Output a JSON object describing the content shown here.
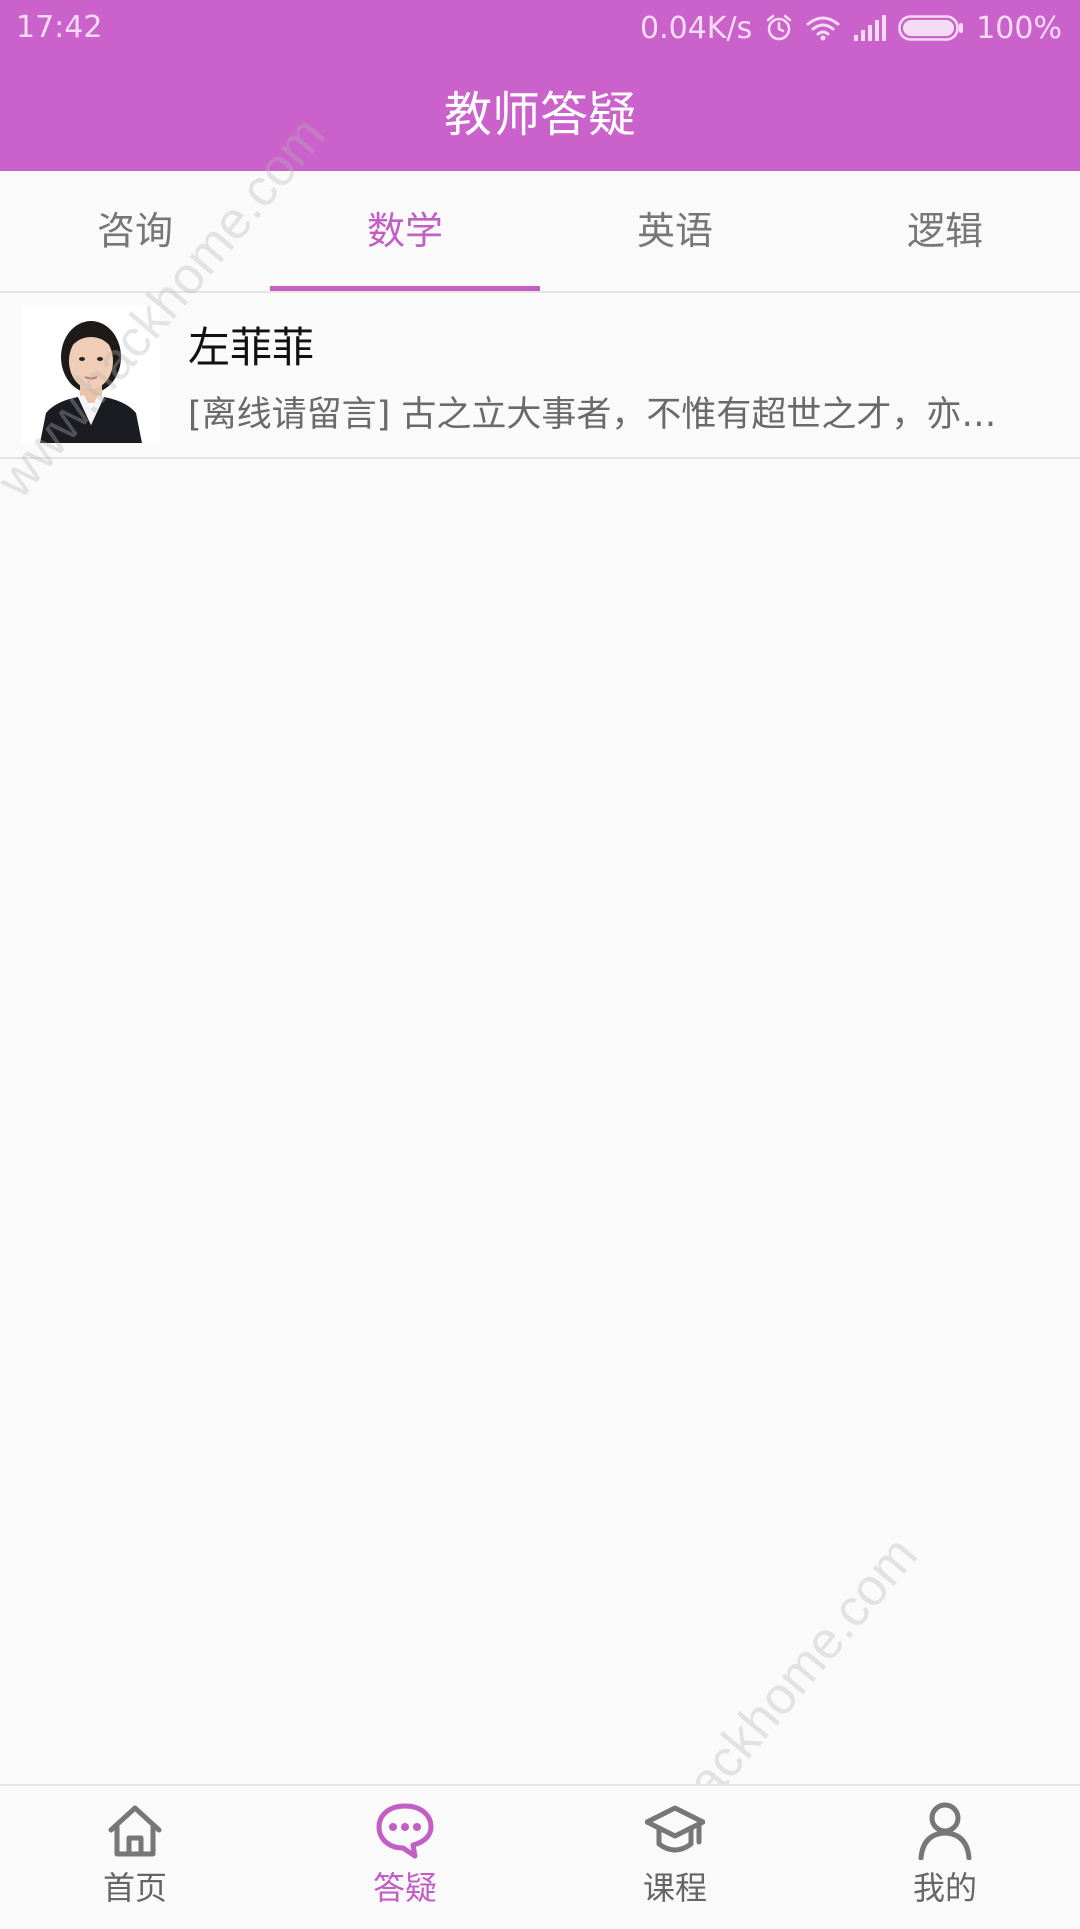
{
  "status_bar": {
    "time": "17:42",
    "network_speed": "0.04K/s",
    "battery": "100%",
    "icons": [
      "alarm-icon",
      "wifi-icon",
      "signal-icon",
      "battery-icon"
    ]
  },
  "header": {
    "title": "教师答疑"
  },
  "tabs": [
    {
      "label": "咨询",
      "active": false
    },
    {
      "label": "数学",
      "active": true
    },
    {
      "label": "英语",
      "active": false
    },
    {
      "label": "逻辑",
      "active": false
    }
  ],
  "teachers": [
    {
      "name": "左菲菲",
      "message": "[离线请留言]  古之立大事者，不惟有超世之才，亦…"
    }
  ],
  "bottom_nav": [
    {
      "label": "首页",
      "icon": "home-icon",
      "active": false
    },
    {
      "label": "答疑",
      "icon": "chat-bubble-icon",
      "active": true
    },
    {
      "label": "课程",
      "icon": "graduation-cap-icon",
      "active": false
    },
    {
      "label": "我的",
      "icon": "person-icon",
      "active": false
    }
  ],
  "watermark": "www.hackhome.com",
  "colors": {
    "accent": "#cb62cb",
    "active_tab": "#c35ec5",
    "background": "#fafafa",
    "inactive_text": "#777777"
  }
}
